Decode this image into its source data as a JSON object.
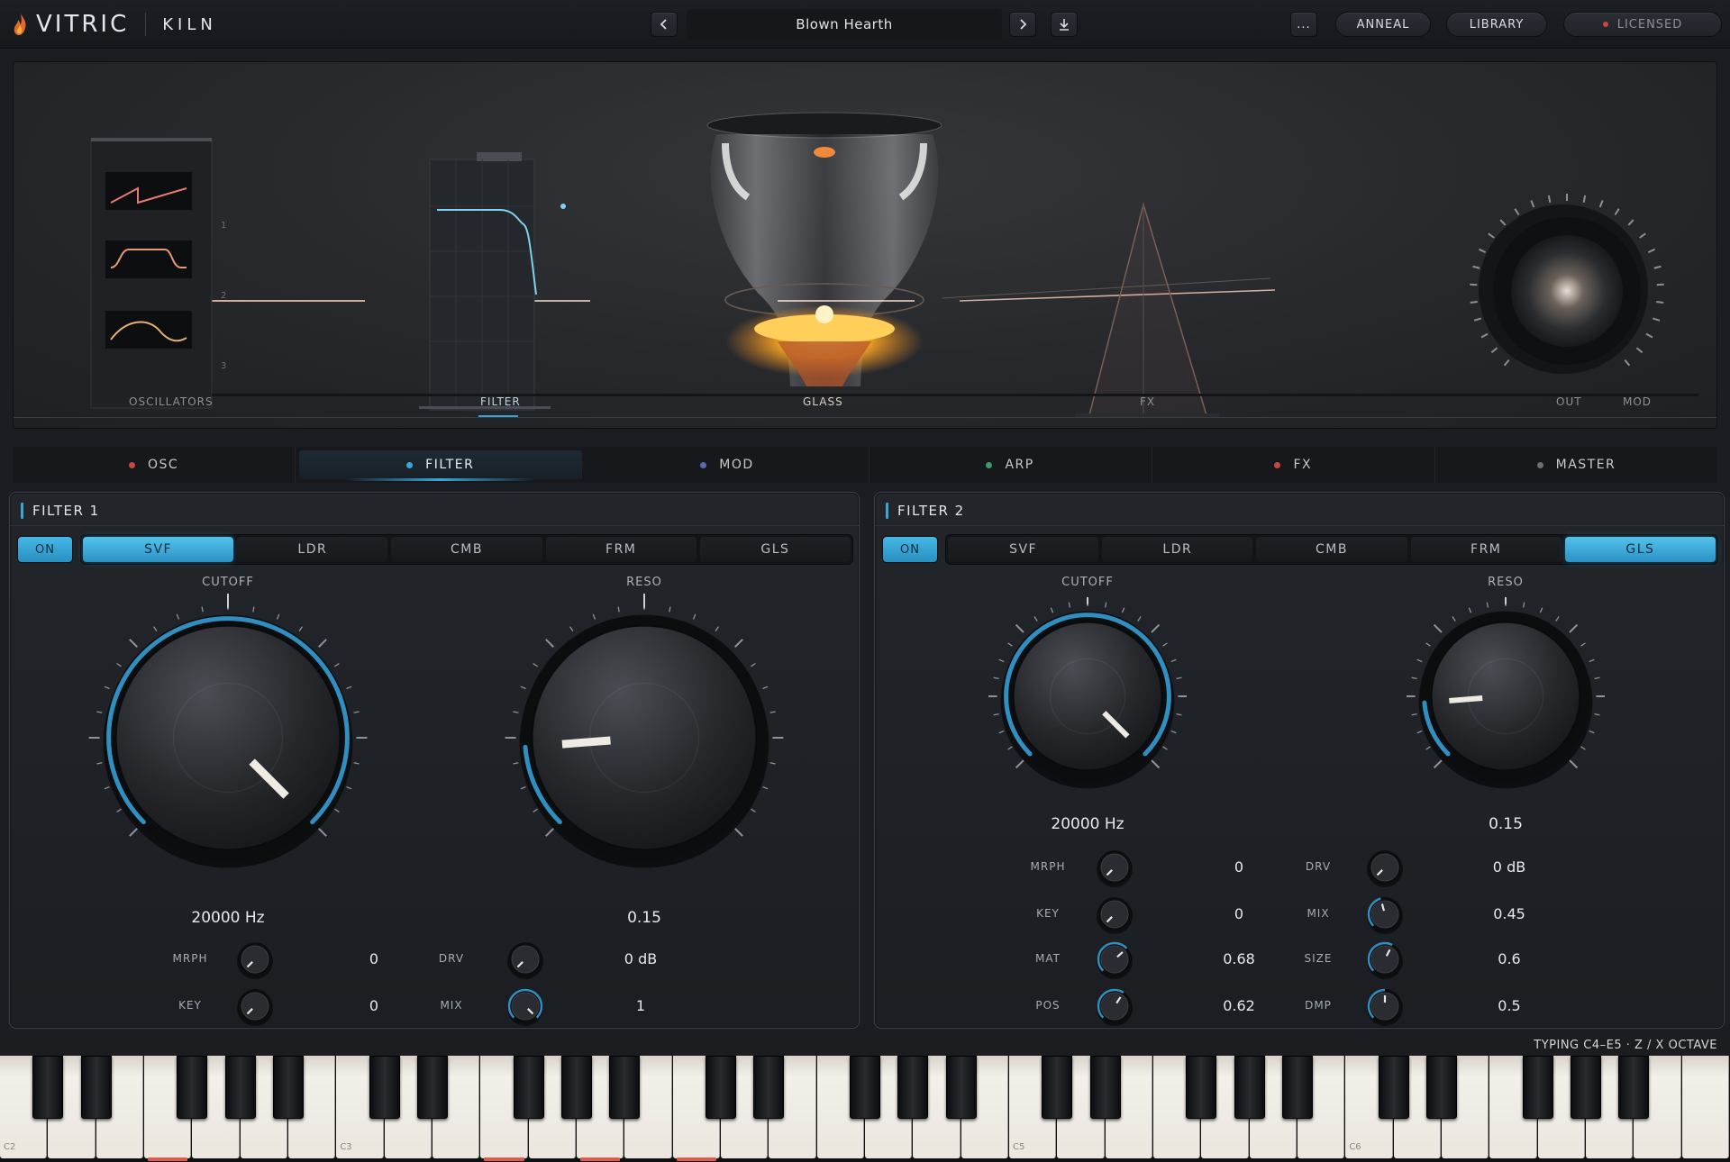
{
  "app": {
    "brand": "VITRIC",
    "product": "KILN"
  },
  "toolbar": {
    "preset_name": "Blown Hearth",
    "prev_icon": "chevron-left-icon",
    "next_icon": "chevron-right-icon",
    "save_icon": "download-icon",
    "more_label": "...",
    "anneal_label": "ANNEAL",
    "library_label": "LIBRARY",
    "licensed_label": "LICENSED"
  },
  "chain": {
    "labels": {
      "oscillators": "OSCILLATORS",
      "filter": "FILTER",
      "glass": "GLASS",
      "fx": "FX",
      "out": "OUT",
      "mod": "MOD"
    },
    "osc_numbers": [
      "1",
      "2",
      "3"
    ]
  },
  "sections": [
    {
      "label": "OSC",
      "dot": "#c9473f",
      "active": false
    },
    {
      "label": "FILTER",
      "dot": "#3aa6d8",
      "active": true
    },
    {
      "label": "MOD",
      "dot": "#5a68b0",
      "active": false
    },
    {
      "label": "ARP",
      "dot": "#3c9a6a",
      "active": false
    },
    {
      "label": "FX",
      "dot": "#c9473f",
      "active": false
    },
    {
      "label": "MASTER",
      "dot": "#6b7078",
      "active": false
    }
  ],
  "filter1": {
    "title": "FILTER 1",
    "on_label": "ON",
    "types": [
      "SVF",
      "LDR",
      "CMB",
      "FRM",
      "GLS"
    ],
    "active_type": 0,
    "cutoff": {
      "label": "CUTOFF",
      "value": "20000 Hz",
      "norm": 1.0
    },
    "reso": {
      "label": "RESO",
      "value": "0.15",
      "norm": 0.15
    },
    "params": [
      {
        "label": "MRPH",
        "value": "0"
      },
      {
        "label": "DRV",
        "value": "0 dB"
      },
      {
        "label": "KEY",
        "value": "0"
      },
      {
        "label": "MIX",
        "value": "1"
      }
    ]
  },
  "filter2": {
    "title": "FILTER 2",
    "on_label": "ON",
    "types": [
      "SVF",
      "LDR",
      "CMB",
      "FRM",
      "GLS"
    ],
    "active_type": 4,
    "cutoff": {
      "label": "CUTOFF",
      "value": "20000 Hz",
      "norm": 1.0
    },
    "reso": {
      "label": "RESO",
      "value": "0.15",
      "norm": 0.15
    },
    "params": [
      {
        "label": "MRPH",
        "value": "0"
      },
      {
        "label": "DRV",
        "value": "0 dB"
      },
      {
        "label": "KEY",
        "value": "0"
      },
      {
        "label": "MIX",
        "value": "0.45"
      },
      {
        "label": "MAT",
        "value": "0.68"
      },
      {
        "label": "SIZE",
        "value": "0.6"
      },
      {
        "label": "POS",
        "value": "0.62"
      },
      {
        "label": "DMP",
        "value": "0.5"
      }
    ]
  },
  "keyboard": {
    "hint": "TYPING C4–E5  ·  Z / X OCTAVE",
    "octave_labels": [
      "C2",
      "C3",
      "C5",
      "C6"
    ]
  },
  "colors": {
    "accent": "#3aa6d8",
    "accent_light": "#54c2ec",
    "active_key": "#e0594a"
  }
}
